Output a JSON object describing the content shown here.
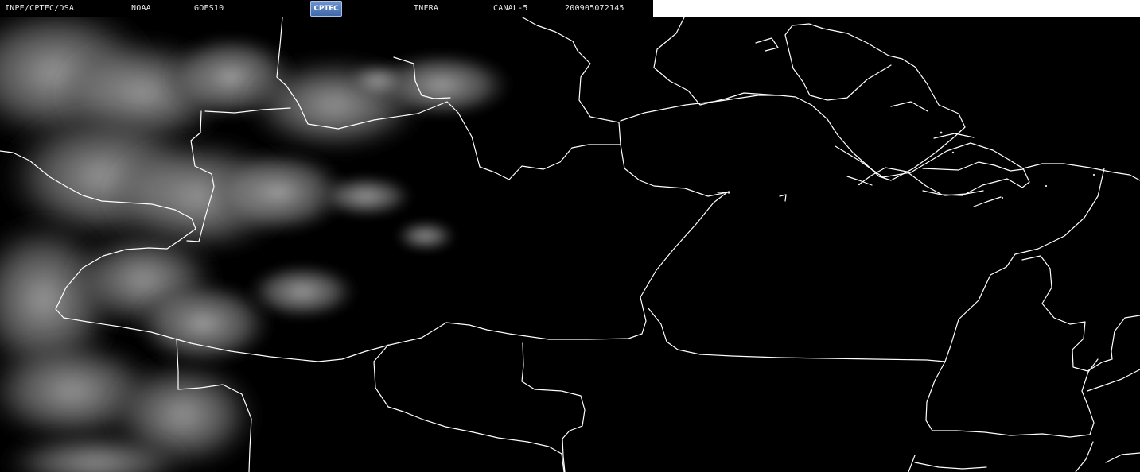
{
  "header": {
    "source": "INPE/CPTEC/DSA",
    "agency": "NOAA",
    "satellite": "GOES10",
    "logo_text": "CPTEC",
    "product": "INFRA",
    "channel": "CANAL-5",
    "timestamp": "200905072145"
  },
  "colors": {
    "background": "#000000",
    "border": "#ffffff",
    "cloud": "#9a9a9a",
    "header_text": "#e9e9e9",
    "header_right_fill": "#ffffff"
  },
  "map": {
    "icon": "satellite-infrared-map"
  }
}
